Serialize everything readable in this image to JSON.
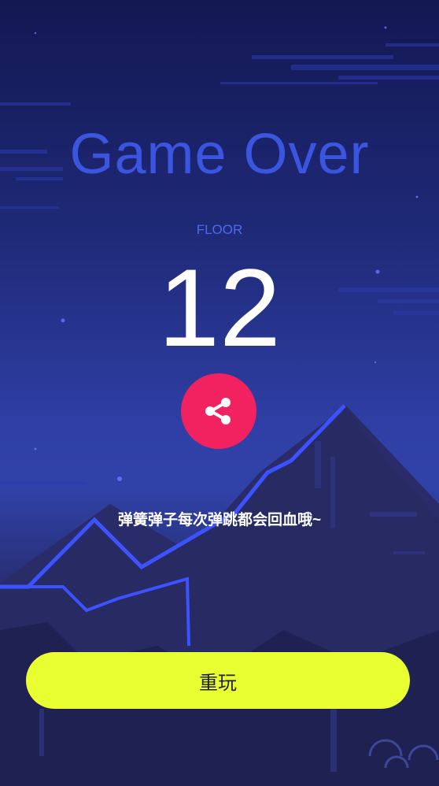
{
  "game": {
    "title": "Game Over",
    "floor_label": "FLOOR",
    "floor_value": "12",
    "hint": "弹簧弹子每次弹跳都会回血哦~",
    "replay_label": "重玩"
  },
  "icons": {
    "share": "share-icon"
  },
  "colors": {
    "title": "#3a55e0",
    "floor_label": "#4d69f0",
    "share_button": "#f2215f",
    "replay_button": "#eaff32",
    "mountain_glow": "#3c52ff"
  }
}
